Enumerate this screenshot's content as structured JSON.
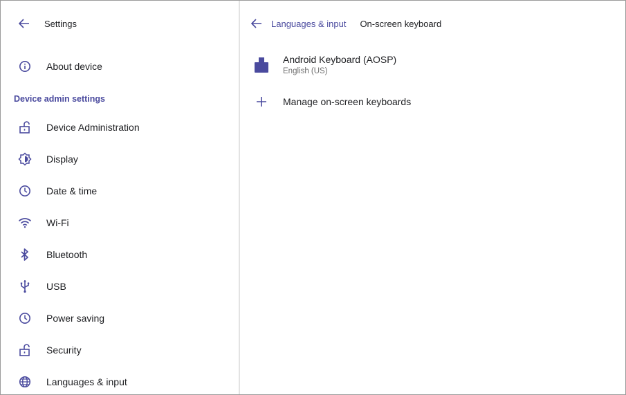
{
  "left_header": {
    "title": "Settings"
  },
  "nav": {
    "about": "About device",
    "section_title": "Device admin settings",
    "items": [
      {
        "label": "Device Administration",
        "icon": "lock-open-icon"
      },
      {
        "label": "Display",
        "icon": "brightness-icon"
      },
      {
        "label": "Date & time",
        "icon": "clock-icon"
      },
      {
        "label": "Wi-Fi",
        "icon": "wifi-icon"
      },
      {
        "label": "Bluetooth",
        "icon": "bluetooth-icon"
      },
      {
        "label": "USB",
        "icon": "usb-icon"
      },
      {
        "label": "Power saving",
        "icon": "clock-icon"
      },
      {
        "label": "Security",
        "icon": "lock-open-icon"
      },
      {
        "label": "Languages & input",
        "icon": "globe-icon"
      }
    ]
  },
  "right_header": {
    "breadcrumb": "Languages & input",
    "current": "On-screen keyboard"
  },
  "keyboards": [
    {
      "name": "Android Keyboard (AOSP)",
      "language": "English (US)"
    }
  ],
  "manage_label": "Manage on-screen keyboards",
  "colors": {
    "accent": "#4a4a9e",
    "icon": "#4a4a9e",
    "text": "#202124",
    "secondary_text": "#6f6f6f",
    "divider": "#e3e3e3"
  }
}
